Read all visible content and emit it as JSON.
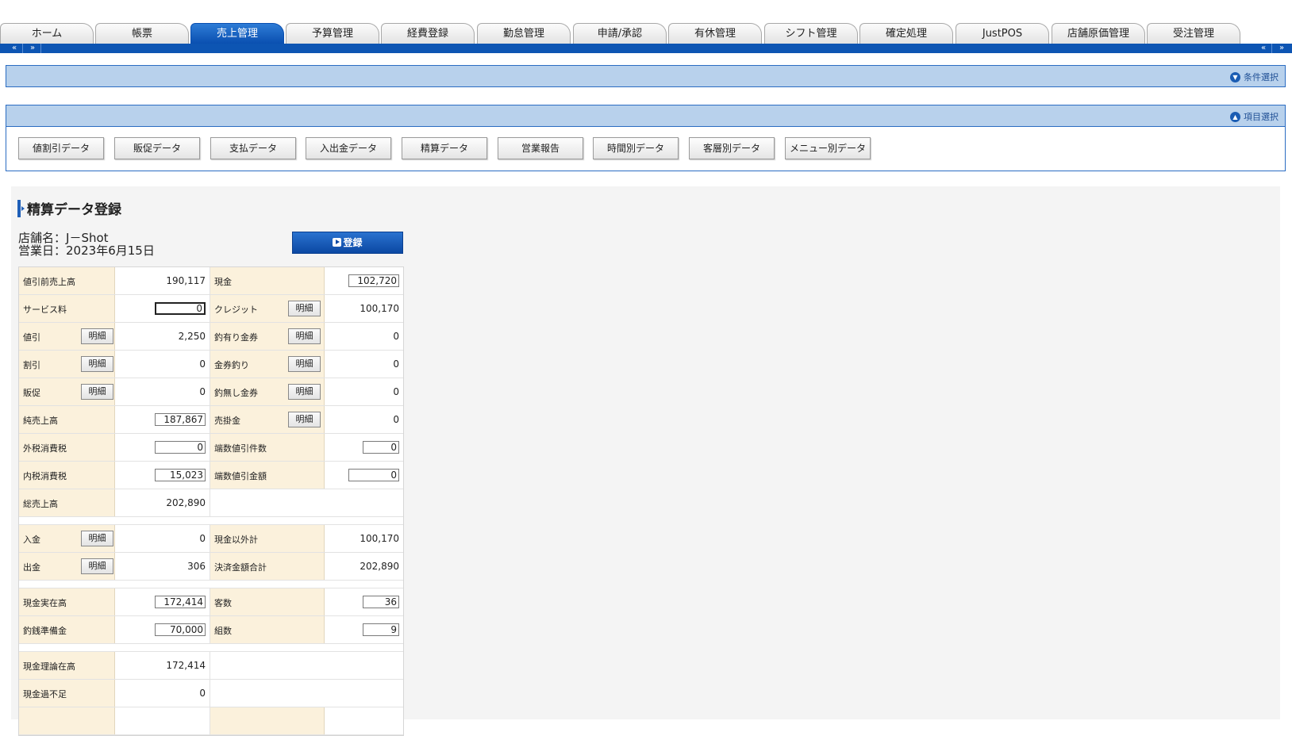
{
  "tabs": [
    {
      "label": "ホーム",
      "active": false
    },
    {
      "label": "帳票",
      "active": false
    },
    {
      "label": "売上管理",
      "active": true
    },
    {
      "label": "予算管理",
      "active": false
    },
    {
      "label": "経費登録",
      "active": false
    },
    {
      "label": "勤怠管理",
      "active": false
    },
    {
      "label": "申請/承認",
      "active": false
    },
    {
      "label": "有休管理",
      "active": false
    },
    {
      "label": "シフト管理",
      "active": false
    },
    {
      "label": "確定処理",
      "active": false
    },
    {
      "label": "JustPOS",
      "active": false
    },
    {
      "label": "店舗原価管理",
      "active": false
    },
    {
      "label": "受注管理",
      "active": false
    }
  ],
  "nav": {
    "prev": "«",
    "next": "»"
  },
  "condition_panel": {
    "label": "条件選択"
  },
  "item_panel": {
    "label": "項目選択"
  },
  "sub_buttons": [
    "値割引データ",
    "販促データ",
    "支払データ",
    "入出金データ",
    "精算データ",
    "営業報告",
    "時間別データ",
    "客層別データ",
    "メニュー別データ"
  ],
  "page": {
    "title": "精算データ登録",
    "store_label": "店舗名：",
    "store_name": "J－Shot",
    "date_label": "営業日：",
    "date": "2023年6月15日",
    "register_label": "登録",
    "detail_label": "明細"
  },
  "grid": {
    "r1": {
      "l1": "値引前売上高",
      "v1": "190,117",
      "l2": "現金",
      "v2": "102,720"
    },
    "r2": {
      "l1": "サービス料",
      "v1": "0",
      "l2": "クレジット",
      "v2": "100,170"
    },
    "r3": {
      "l1": "値引",
      "v1": "2,250",
      "l2": "釣有り金券",
      "v2": "0"
    },
    "r4": {
      "l1": "割引",
      "v1": "0",
      "l2": "金券釣り",
      "v2": "0"
    },
    "r5": {
      "l1": "販促",
      "v1": "0",
      "l2": "釣無し金券",
      "v2": "0"
    },
    "r6": {
      "l1": "純売上高",
      "v1": "187,867",
      "l2": "売掛金",
      "v2": "0"
    },
    "r7": {
      "l1": "外税消費税",
      "v1": "0",
      "l2": "端数値引件数",
      "v2": "0"
    },
    "r8": {
      "l1": "内税消費税",
      "v1": "15,023",
      "l2": "端数値引金額",
      "v2": "0"
    },
    "r9": {
      "l1": "総売上高",
      "v1": "202,890"
    },
    "r10": {
      "l1": "入金",
      "v1": "0",
      "l2": "現金以外計",
      "v2": "100,170"
    },
    "r11": {
      "l1": "出金",
      "v1": "306",
      "l2": "決済金額合計",
      "v2": "202,890"
    },
    "r12": {
      "l1": "現金実在高",
      "v1": "172,414",
      "l2": "客数",
      "v2": "36"
    },
    "r13": {
      "l1": "釣銭準備金",
      "v1": "70,000",
      "l2": "組数",
      "v2": "9"
    },
    "r14": {
      "l1": "現金理論在高",
      "v1": "172,414"
    },
    "r15": {
      "l1": "現金過不足",
      "v1": "0"
    }
  }
}
